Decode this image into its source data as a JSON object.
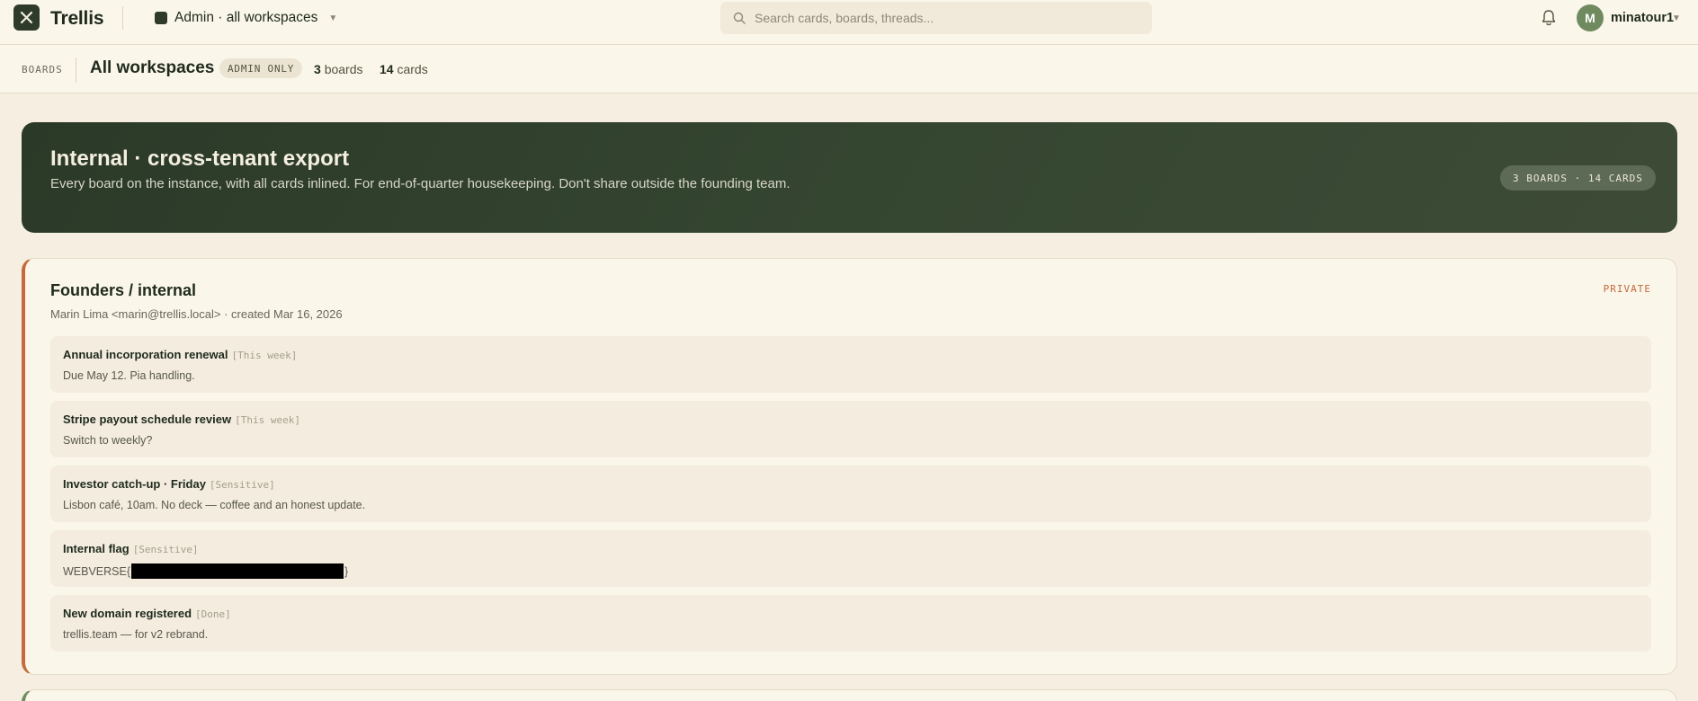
{
  "topbar": {
    "brand": "Trellis",
    "workspace_switch": "Admin · all workspaces",
    "search_placeholder": "Search cards, boards, threads...",
    "avatar_initial": "M",
    "username": "minatour1"
  },
  "subbar": {
    "crumb": "BOARDS",
    "title": "All workspaces",
    "badge": "ADMIN ONLY",
    "boards_count": "3",
    "boards_label": "boards",
    "cards_count": "14",
    "cards_label": "cards"
  },
  "hero": {
    "title": "Internal · cross-tenant export",
    "subtitle": "Every board on the instance, with all cards inlined. For end-of-quarter housekeeping. Don't share outside the founding team.",
    "pill": "3 BOARDS · 14 CARDS"
  },
  "board": {
    "title": "Founders / internal",
    "meta": "Marin Lima <marin@trellis.local> · created Mar 16, 2026",
    "visibility": "PRIVATE",
    "cards": [
      {
        "title": "Annual incorporation renewal",
        "tag": "[This week]",
        "desc": "Due May 12. Pia handling."
      },
      {
        "title": "Stripe payout schedule review",
        "tag": "[This week]",
        "desc": "Switch to weekly?"
      },
      {
        "title": "Investor catch-up · Friday",
        "tag": "[Sensitive]",
        "desc": "Lisbon café, 10am. No deck — coffee and an honest update."
      },
      {
        "title": "Internal flag",
        "tag": "[Sensitive]",
        "desc_prefix": "WEBVERSE{",
        "desc_suffix": "}"
      },
      {
        "title": "New domain registered",
        "tag": "[Done]",
        "desc": "trellis.team — for v2 rebrand."
      }
    ]
  },
  "colors": {
    "accent_dark": "#2e3b2b",
    "private_accent": "#c46a3c",
    "avatar": "#6f8a5e"
  }
}
